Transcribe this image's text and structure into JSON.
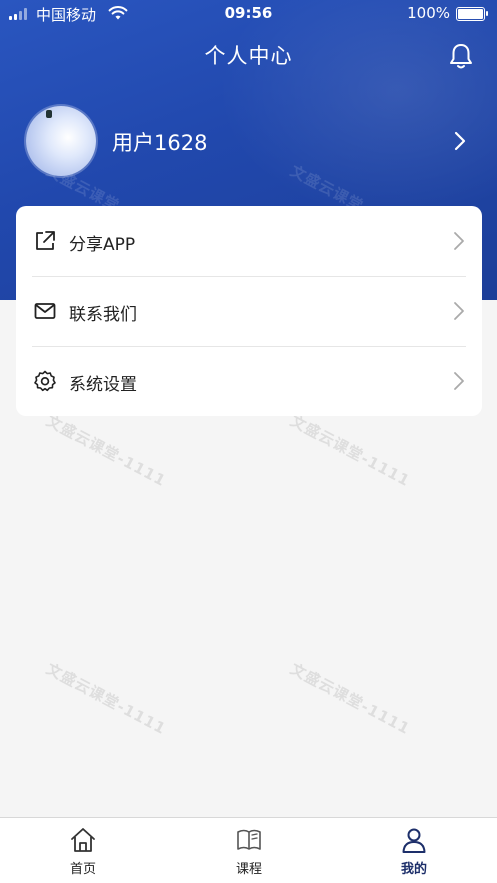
{
  "status_bar": {
    "carrier": "中国移动",
    "time": "09:56",
    "battery": "100%"
  },
  "header": {
    "title": "个人中心"
  },
  "profile": {
    "username": "用户1628"
  },
  "menu": {
    "items": [
      {
        "label": "分享APP",
        "icon": "share-icon"
      },
      {
        "label": "联系我们",
        "icon": "mail-icon"
      },
      {
        "label": "系统设置",
        "icon": "gear-icon"
      }
    ]
  },
  "watermark": "文盛云课堂-1111",
  "tabbar": {
    "tabs": [
      {
        "label": "首页",
        "icon": "home-icon",
        "active": false
      },
      {
        "label": "课程",
        "icon": "book-icon",
        "active": false
      },
      {
        "label": "我的",
        "icon": "user-icon",
        "active": true
      }
    ]
  },
  "colors": {
    "brand_blue": "#2148ad",
    "active_tab": "#1d2f6a",
    "background": "#f5f5f5"
  }
}
